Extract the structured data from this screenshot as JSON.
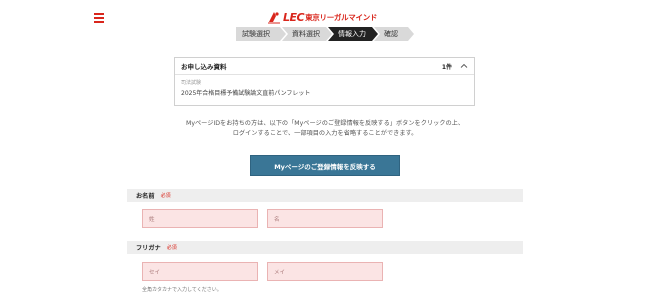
{
  "header": {
    "menu_icon": "hamburger-icon",
    "logo_brand": "LEC",
    "logo_text": "東京リーガルマインド"
  },
  "steps": [
    "試験選択",
    "資料選択",
    "情報入力",
    "確認"
  ],
  "active_step": 2,
  "application": {
    "title": "お申し込み資料",
    "count": "1件",
    "toggle_icon": "chevron-up-icon",
    "category": "司法試験",
    "item": "2025年合格目標予備試験論文直前パンフレット"
  },
  "notice": {
    "line1": "MyページIDをお持ちの方は、以下の「Myページのご登録情報を反映する」ボタンをクリックの上、",
    "line2": "ログインすることで、一部項目の入力を省略することができます。"
  },
  "reflect_button": "Myページのご登録情報を反映する",
  "form": {
    "name": {
      "label": "お名前",
      "required": "必須",
      "last_placeholder": "姓",
      "first_placeholder": "名"
    },
    "kana": {
      "label": "フリガナ",
      "required": "必須",
      "last_placeholder": "セイ",
      "first_placeholder": "メイ",
      "hint": "全角カタカナで入力してください。"
    }
  },
  "colors": {
    "brand": "#d9261c",
    "button": "#3a7696",
    "field_bg": "#fbe4e4",
    "active_step": "#222222"
  }
}
